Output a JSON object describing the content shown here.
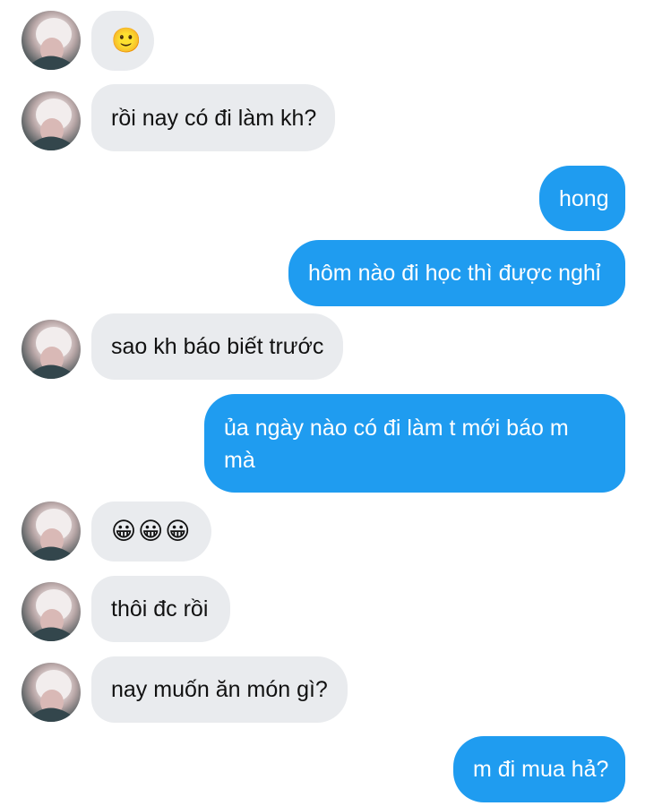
{
  "colors": {
    "incoming_bubble": "#e9ebee",
    "outgoing_bubble": "#1f9cf0",
    "incoming_text": "#111111",
    "outgoing_text": "#ffffff"
  },
  "messages": [
    {
      "sender": "contact",
      "text": "🙂"
    },
    {
      "sender": "contact",
      "text": "rồi nay có đi làm kh?"
    },
    {
      "sender": "me",
      "text": "hong"
    },
    {
      "sender": "me",
      "text": "hôm nào đi học thì được nghỉ"
    },
    {
      "sender": "contact",
      "text": "sao kh báo biết trước"
    },
    {
      "sender": "me",
      "text": "ủa ngày nào có đi làm t mới báo m mà"
    },
    {
      "sender": "contact",
      "text": "😀😀😀"
    },
    {
      "sender": "contact",
      "text": "thôi đc rồi"
    },
    {
      "sender": "contact",
      "text": "nay muốn ăn món gì?"
    },
    {
      "sender": "me",
      "text": "m đi mua hả?"
    }
  ]
}
